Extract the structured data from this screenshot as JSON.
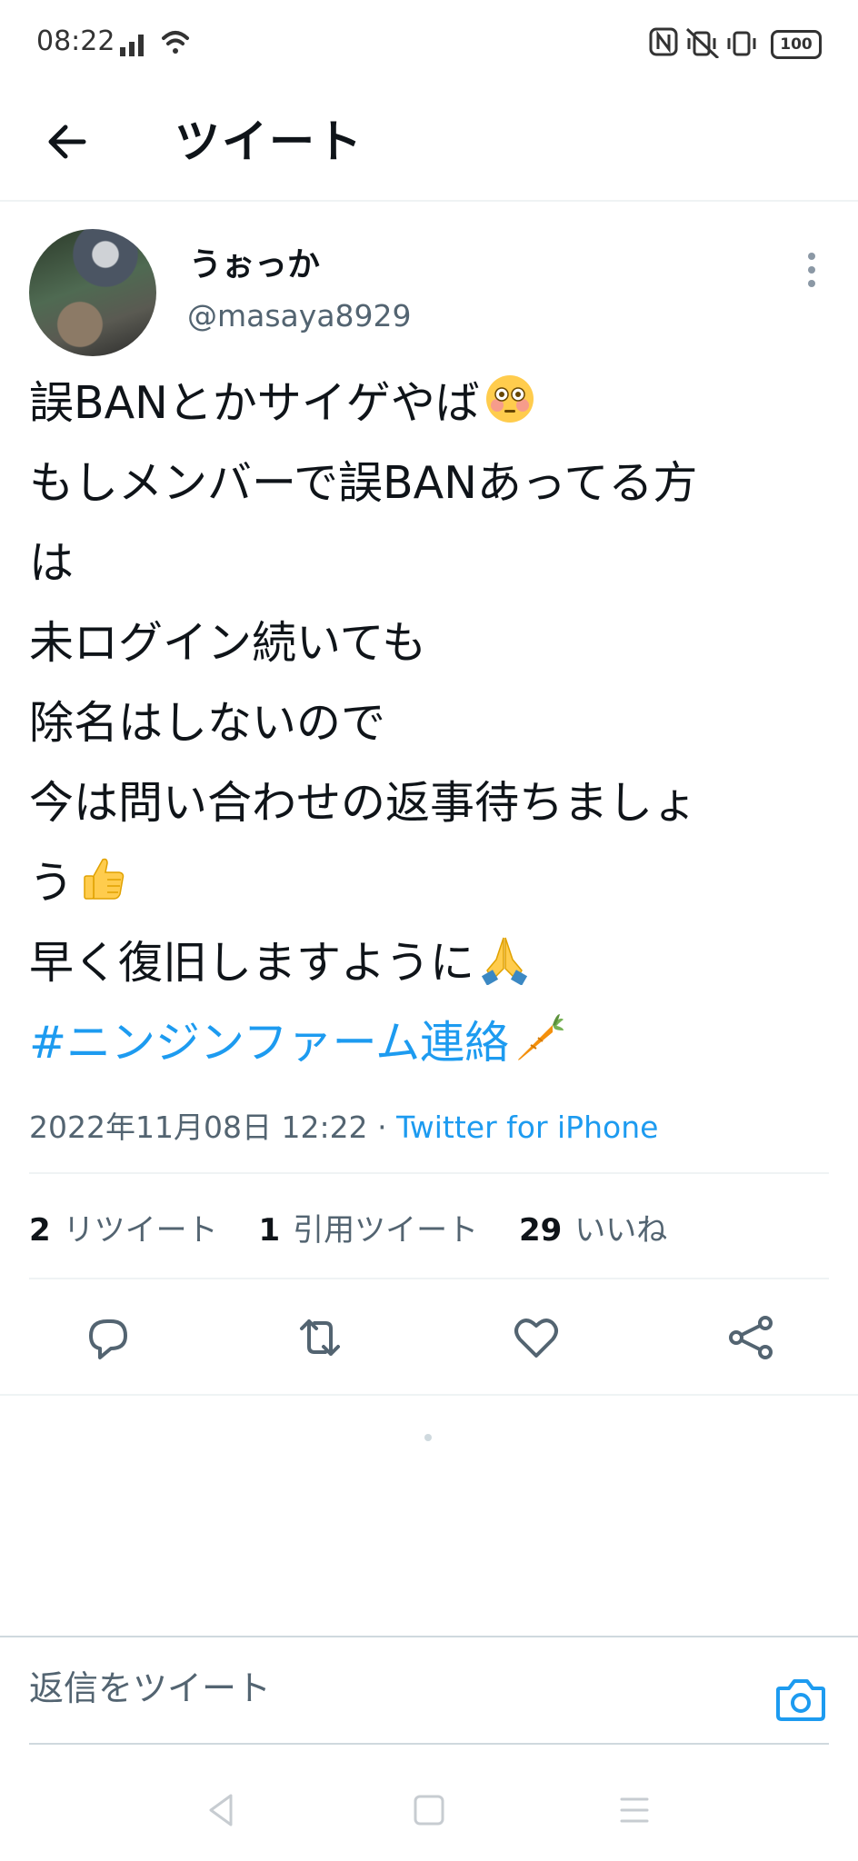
{
  "status_bar": {
    "time": "08:22",
    "battery": "100",
    "left_icons": [
      "signal-icon",
      "wifi-icon"
    ],
    "right_icons": [
      "nfc-icon",
      "vibrate-off-icon",
      "vibrate-icon",
      "battery-icon"
    ]
  },
  "header": {
    "title": "ツイート",
    "back_icon": "arrow-left-icon"
  },
  "tweet": {
    "display_name": "うぉっか",
    "handle": "@masaya8929",
    "more_icon": "more-vertical-icon",
    "lines": [
      "誤BANとかサイゲやば",
      "もしメンバーで誤BANあってる方",
      "は",
      "未ログイン続いても",
      "除名はしないので",
      "今は問い合わせの返事待ちましょ",
      "う",
      "早く復旧しますように"
    ],
    "emojis": {
      "line1": "flushed-face-emoji",
      "line7": "thumbs-up-emoji",
      "line8": "folded-hands-emoji",
      "hashtag": "carrot-emoji"
    },
    "hashtag": "#ニンジンファーム連絡",
    "timestamp": "2022年11月08日 12:22",
    "separator": "·",
    "source": "Twitter for iPhone"
  },
  "stats": {
    "retweets_count": "2",
    "retweets_label": "リツイート",
    "quotes_count": "1",
    "quotes_label": "引用ツイート",
    "likes_count": "29",
    "likes_label": "いいね"
  },
  "actions": [
    "reply-icon",
    "retweet-icon",
    "like-icon",
    "share-icon"
  ],
  "reply": {
    "placeholder": "返信をツイート",
    "camera_icon": "camera-icon"
  },
  "nav": [
    "back-icon",
    "home-icon",
    "menu-icon"
  ],
  "colors": {
    "accent": "#1d9bf0",
    "text_primary": "#0f1419",
    "text_secondary": "#536471",
    "divider": "#eff3f4"
  }
}
